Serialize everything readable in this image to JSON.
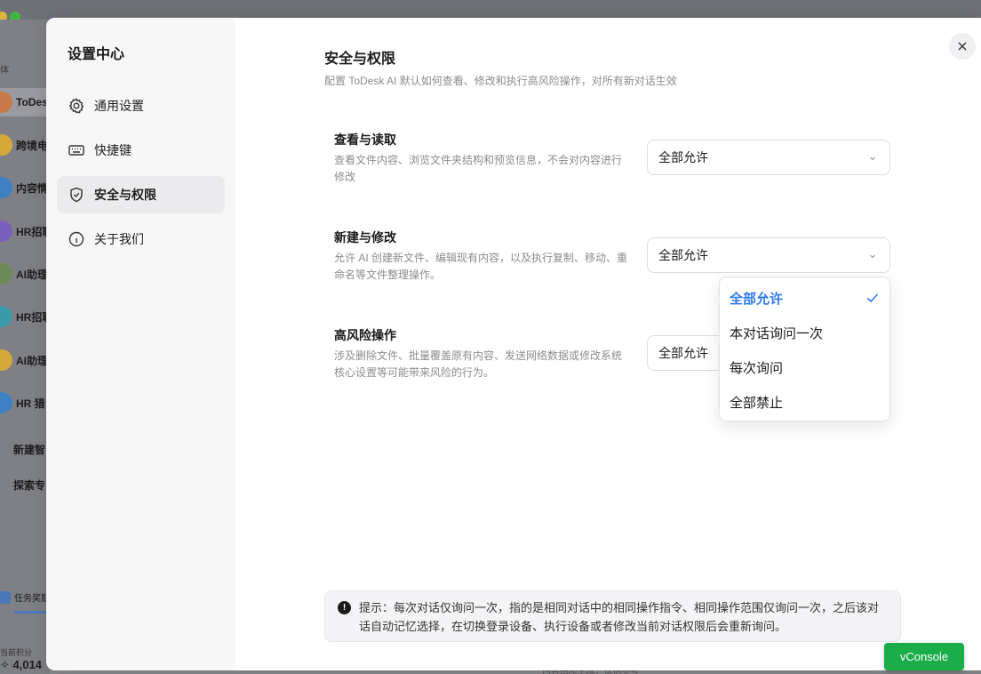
{
  "background": {
    "sidebar_section_label": "体",
    "chat_items": [
      {
        "label": "ToDesk",
        "color": "#c87a4a"
      },
      {
        "label": "跨境电",
        "color": "#d4a93a"
      },
      {
        "label": "内容情",
        "color": "#3f7fc4"
      },
      {
        "label": "HR招聘",
        "color": "#7a5fbf"
      },
      {
        "label": "AI助理",
        "color": "#6b8a5a"
      },
      {
        "label": "HR招聘",
        "color": "#3a9aa8"
      },
      {
        "label": "AI助理",
        "color": "#d4a93a"
      },
      {
        "label": "HR 猎",
        "color": "#3f7fc4"
      }
    ],
    "new_agent": "新建智",
    "explore": "探索专",
    "task_reward": "任务奖励",
    "points_label": "当前积分",
    "points_value": "✧ 4,014",
    "footer_note": "内容由AI生成，仅供参考"
  },
  "modal": {
    "nav_title": "设置中心",
    "nav_items": [
      {
        "label": "通用设置",
        "icon": "gear-icon"
      },
      {
        "label": "快捷键",
        "icon": "keyboard-icon"
      },
      {
        "label": "安全与权限",
        "icon": "shield-icon"
      },
      {
        "label": "关于我们",
        "icon": "info-icon"
      }
    ],
    "active_nav": "安全与权限",
    "title": "安全与权限",
    "subtitle": "配置 ToDesk AI 默认如何查看、修改和执行高风险操作，对所有新对话生效",
    "permissions": [
      {
        "title": "查看与读取",
        "desc": "查看文件内容、浏览文件夹结构和预览信息，不会对内容进行修改",
        "value": "全部允许"
      },
      {
        "title": "新建与修改",
        "desc": "允许 AI 创建新文件、编辑现有内容，以及执行复制、移动、重命名等文件整理操作。",
        "value": "全部允许"
      },
      {
        "title": "高风险操作",
        "desc": "涉及删除文件、批量覆盖原有内容、发送网络数据或修改系统核心设置等可能带来风险的行为。",
        "value": "全部允许"
      }
    ],
    "dropdown_options": [
      "全部允许",
      "本对话询问一次",
      "每次询问",
      "全部禁止"
    ],
    "dropdown_selected": "全部允许",
    "tip": "提示：每次对话仅询问一次，指的是相同对话中的相同操作指令、相同操作范围仅询问一次，之后该对话自动记忆选择，在切换登录设备、执行设备或者修改当前对话权限后会重新询问。",
    "accent_color": "#2f7af0"
  },
  "vconsole_label": "vConsole"
}
